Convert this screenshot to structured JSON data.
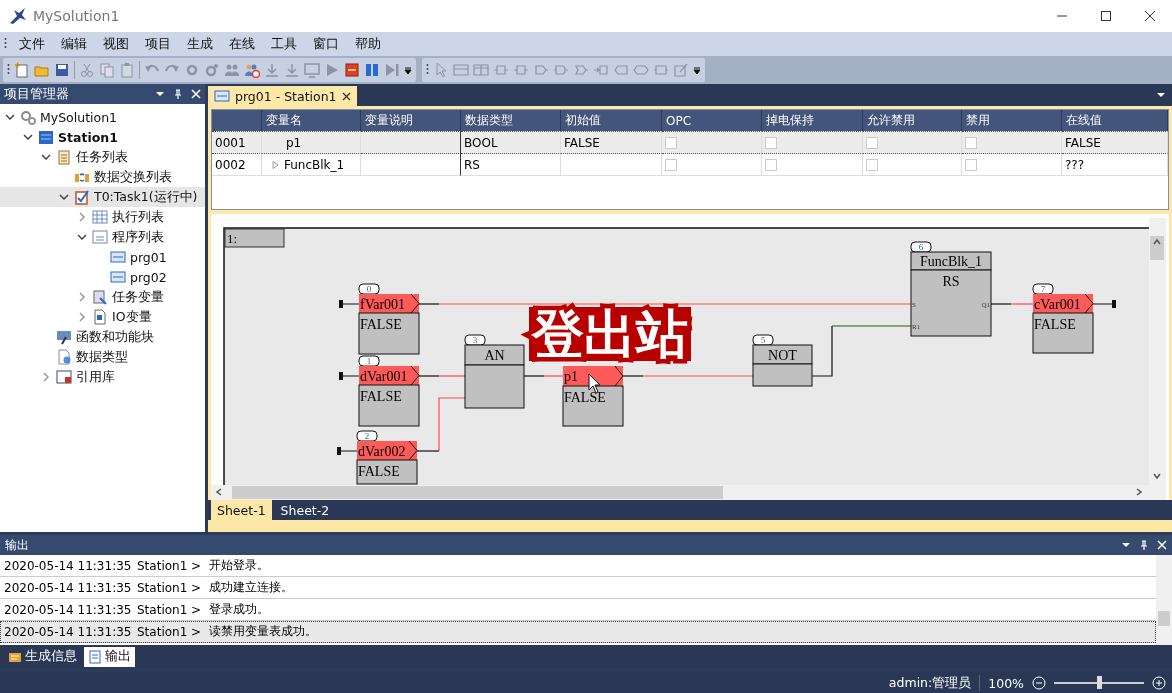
{
  "window": {
    "title": "MySolution1"
  },
  "menu": [
    "文件",
    "编辑",
    "视图",
    "项目",
    "生成",
    "在线",
    "工具",
    "窗口",
    "帮助"
  ],
  "project_panel": {
    "title": "项目管理器",
    "tree": [
      {
        "label": "MySolution1",
        "kind": "solution",
        "expanded": true,
        "selected": false,
        "children": [
          {
            "label": "Station1",
            "kind": "station",
            "expanded": true,
            "selected": false,
            "children": [
              {
                "label": "任务列表",
                "kind": "tasklist",
                "expanded": true,
                "selected": false,
                "children": [
                  {
                    "label": "数据交换列表",
                    "kind": "exchange",
                    "selected": false
                  },
                  {
                    "label": "T0:Task1(运行中)",
                    "kind": "task",
                    "expanded": true,
                    "selected": true,
                    "children": [
                      {
                        "label": "执行列表",
                        "kind": "execlist",
                        "expanded": false,
                        "selected": false
                      },
                      {
                        "label": "程序列表",
                        "kind": "proglist",
                        "expanded": true,
                        "selected": false,
                        "children": [
                          {
                            "label": "prg01",
                            "kind": "program",
                            "selected": false
                          },
                          {
                            "label": "prg02",
                            "kind": "program",
                            "selected": false
                          }
                        ]
                      },
                      {
                        "label": "任务变量",
                        "kind": "taskvars",
                        "expanded": false,
                        "selected": false
                      },
                      {
                        "label": "IO变量",
                        "kind": "iovars",
                        "expanded": false,
                        "selected": false
                      }
                    ]
                  }
                ]
              },
              {
                "label": "函数和功能块",
                "kind": "functions",
                "selected": false
              },
              {
                "label": "数据类型",
                "kind": "datatypes",
                "selected": false
              },
              {
                "label": "引用库",
                "kind": "library",
                "expanded": false,
                "selected": false
              }
            ]
          }
        ]
      }
    ]
  },
  "editor": {
    "tabs": [
      {
        "label": "prg01 - Station1",
        "selected": true
      }
    ],
    "variable_table": {
      "columns": [
        "变量名",
        "变量说明",
        "数据类型",
        "初始值",
        "OPC",
        "掉电保持",
        "允许禁用",
        "禁用",
        "在线值"
      ],
      "rows": [
        {
          "number": "0001",
          "name": "p1",
          "expandable": false,
          "type": "BOOL",
          "initial": "FALSE",
          "opc": false,
          "retain": false,
          "allow_disable": false,
          "disabled": false,
          "online": "FALSE",
          "selected": true
        },
        {
          "number": "0002",
          "name": "FuncBlk_1",
          "expandable": true,
          "type": "RS",
          "opc": false,
          "retain": false,
          "allow_disable": false,
          "disabled": false,
          "online": "???",
          "selected": false
        }
      ]
    },
    "diagram": {
      "label": "1:",
      "caption": "登出站",
      "blocks": [
        {
          "kind": "variable",
          "number": "0",
          "name": "fVar001",
          "value": "FALSE"
        },
        {
          "kind": "variable",
          "number": "1",
          "name": "dVar001",
          "value": "FALSE"
        },
        {
          "kind": "variable",
          "number": "2",
          "name": "dVar002",
          "value": "FALSE"
        },
        {
          "kind": "function",
          "number": "3",
          "name": "AN"
        },
        {
          "kind": "variable",
          "name": "p1",
          "value": "FALSE"
        },
        {
          "kind": "function",
          "number": "5",
          "name": "NOT"
        },
        {
          "kind": "block",
          "number": "6",
          "name": "FuncBlk_1",
          "type": "RS",
          "inputs": [
            "S",
            "R1"
          ],
          "outputs": [
            "Q1"
          ]
        },
        {
          "kind": "variable",
          "number": "7",
          "name": "cVar001",
          "value": "FALSE"
        }
      ]
    },
    "sheets": [
      {
        "label": "Sheet-1",
        "selected": true
      },
      {
        "label": "Sheet-2",
        "selected": false
      }
    ]
  },
  "output_panel": {
    "title": "输出",
    "rows": [
      {
        "time": "2020-05-14 11:31:35",
        "source": "Station1 >",
        "message": "开始登录。",
        "selected": false
      },
      {
        "time": "2020-05-14 11:31:35",
        "source": "Station1 >",
        "message": "成功建立连接。",
        "selected": false
      },
      {
        "time": "2020-05-14 11:31:35",
        "source": "Station1 >",
        "message": "登录成功。",
        "selected": false
      },
      {
        "time": "2020-05-14 11:31:35",
        "source": "Station1 >",
        "message": "读禁用变量表成功。",
        "selected": true
      }
    ],
    "tabs": [
      {
        "label": "生成信息",
        "selected": false
      },
      {
        "label": "输出",
        "selected": true
      }
    ]
  },
  "status_bar": {
    "user": "admin:管理员",
    "zoom": "100%",
    "zoom_slider": {
      "level": 0.5
    }
  }
}
